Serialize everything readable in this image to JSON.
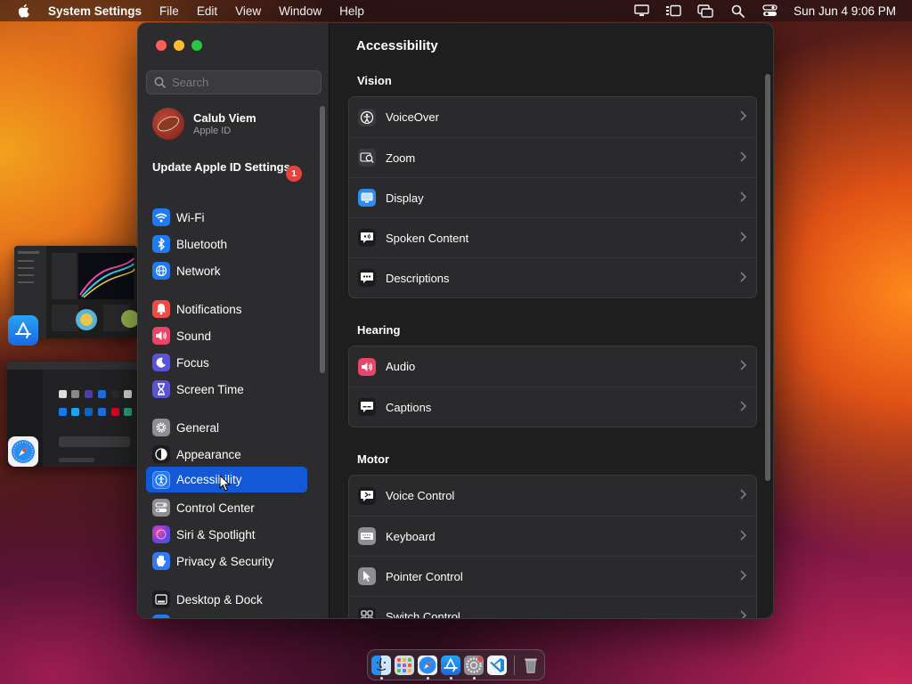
{
  "menubar": {
    "app_name": "System Settings",
    "menus": [
      "File",
      "Edit",
      "View",
      "Window",
      "Help"
    ],
    "clock": "Sun Jun 4  9:06 PM",
    "status_icons": [
      "display-icon",
      "stage-manager-icon",
      "screen-mirroring-icon",
      "spotlight-search-icon",
      "control-center-icon"
    ]
  },
  "sidebar": {
    "search_placeholder": "Search",
    "profile": {
      "name": "Calub Viem",
      "subtitle": "Apple ID"
    },
    "update_label": "Update Apple ID Settings",
    "update_badge": "1",
    "items": [
      {
        "label": "Wi-Fi",
        "icon": "wifi-icon",
        "color": "#1f7af6"
      },
      {
        "label": "Bluetooth",
        "icon": "bluetooth-icon",
        "color": "#1f7af6"
      },
      {
        "label": "Network",
        "icon": "globe-icon",
        "color": "#1f7af6"
      },
      {
        "label": "Notifications",
        "icon": "bell-icon",
        "color": "#ee4b47"
      },
      {
        "label": "Sound",
        "icon": "speaker-icon",
        "color": "#e94469"
      },
      {
        "label": "Focus",
        "icon": "moon-icon",
        "color": "#5b53d6"
      },
      {
        "label": "Screen Time",
        "icon": "hourglass-icon",
        "color": "#5b53d6"
      },
      {
        "label": "General",
        "icon": "gear-icon",
        "color": "#8e8e93"
      },
      {
        "label": "Appearance",
        "icon": "appearance-icon",
        "color": "#1c1c1e"
      },
      {
        "label": "Accessibility",
        "icon": "accessibility-icon",
        "color": "#1f7af6",
        "selected": true
      },
      {
        "label": "Control Center",
        "icon": "control-center-icon",
        "color": "#8e8e93"
      },
      {
        "label": "Siri & Spotlight",
        "icon": "siri-icon",
        "color": "#9d3fd8"
      },
      {
        "label": "Privacy & Security",
        "icon": "hand-icon",
        "color": "#3478f6"
      },
      {
        "label": "Desktop & Dock",
        "icon": "dock-icon",
        "color": "#1c1c1e"
      }
    ]
  },
  "main": {
    "title": "Accessibility",
    "sections": [
      {
        "title": "Vision",
        "rows": [
          {
            "label": "VoiceOver",
            "icon": "voiceover-icon",
            "color": "#3a3a3c"
          },
          {
            "label": "Zoom",
            "icon": "zoom-icon",
            "color": "#3a3a3c"
          },
          {
            "label": "Display",
            "icon": "display-icon",
            "color": "#2d8cf0"
          },
          {
            "label": "Spoken Content",
            "icon": "spoken-content-icon",
            "color": "#1c1c1e"
          },
          {
            "label": "Descriptions",
            "icon": "descriptions-icon",
            "color": "#1c1c1e"
          }
        ]
      },
      {
        "title": "Hearing",
        "rows": [
          {
            "label": "Audio",
            "icon": "audio-icon",
            "color": "#e94469"
          },
          {
            "label": "Captions",
            "icon": "captions-icon",
            "color": "#1c1c1e"
          }
        ]
      },
      {
        "title": "Motor",
        "rows": [
          {
            "label": "Voice Control",
            "icon": "voice-control-icon",
            "color": "#1c1c1e"
          },
          {
            "label": "Keyboard",
            "icon": "keyboard-icon",
            "color": "#8e8e93"
          },
          {
            "label": "Pointer Control",
            "icon": "pointer-icon",
            "color": "#8e8e93"
          },
          {
            "label": "Switch Control",
            "icon": "switch-control-icon",
            "color": "#1c1c1e"
          }
        ]
      }
    ]
  },
  "dock": {
    "apps": [
      "finder-icon",
      "launchpad-icon",
      "safari-icon",
      "app-store-icon",
      "system-settings-icon",
      "vscode-icon",
      "trash-icon"
    ]
  },
  "stage_manager": {
    "apps": [
      "app-store-icon",
      "safari-icon"
    ]
  }
}
